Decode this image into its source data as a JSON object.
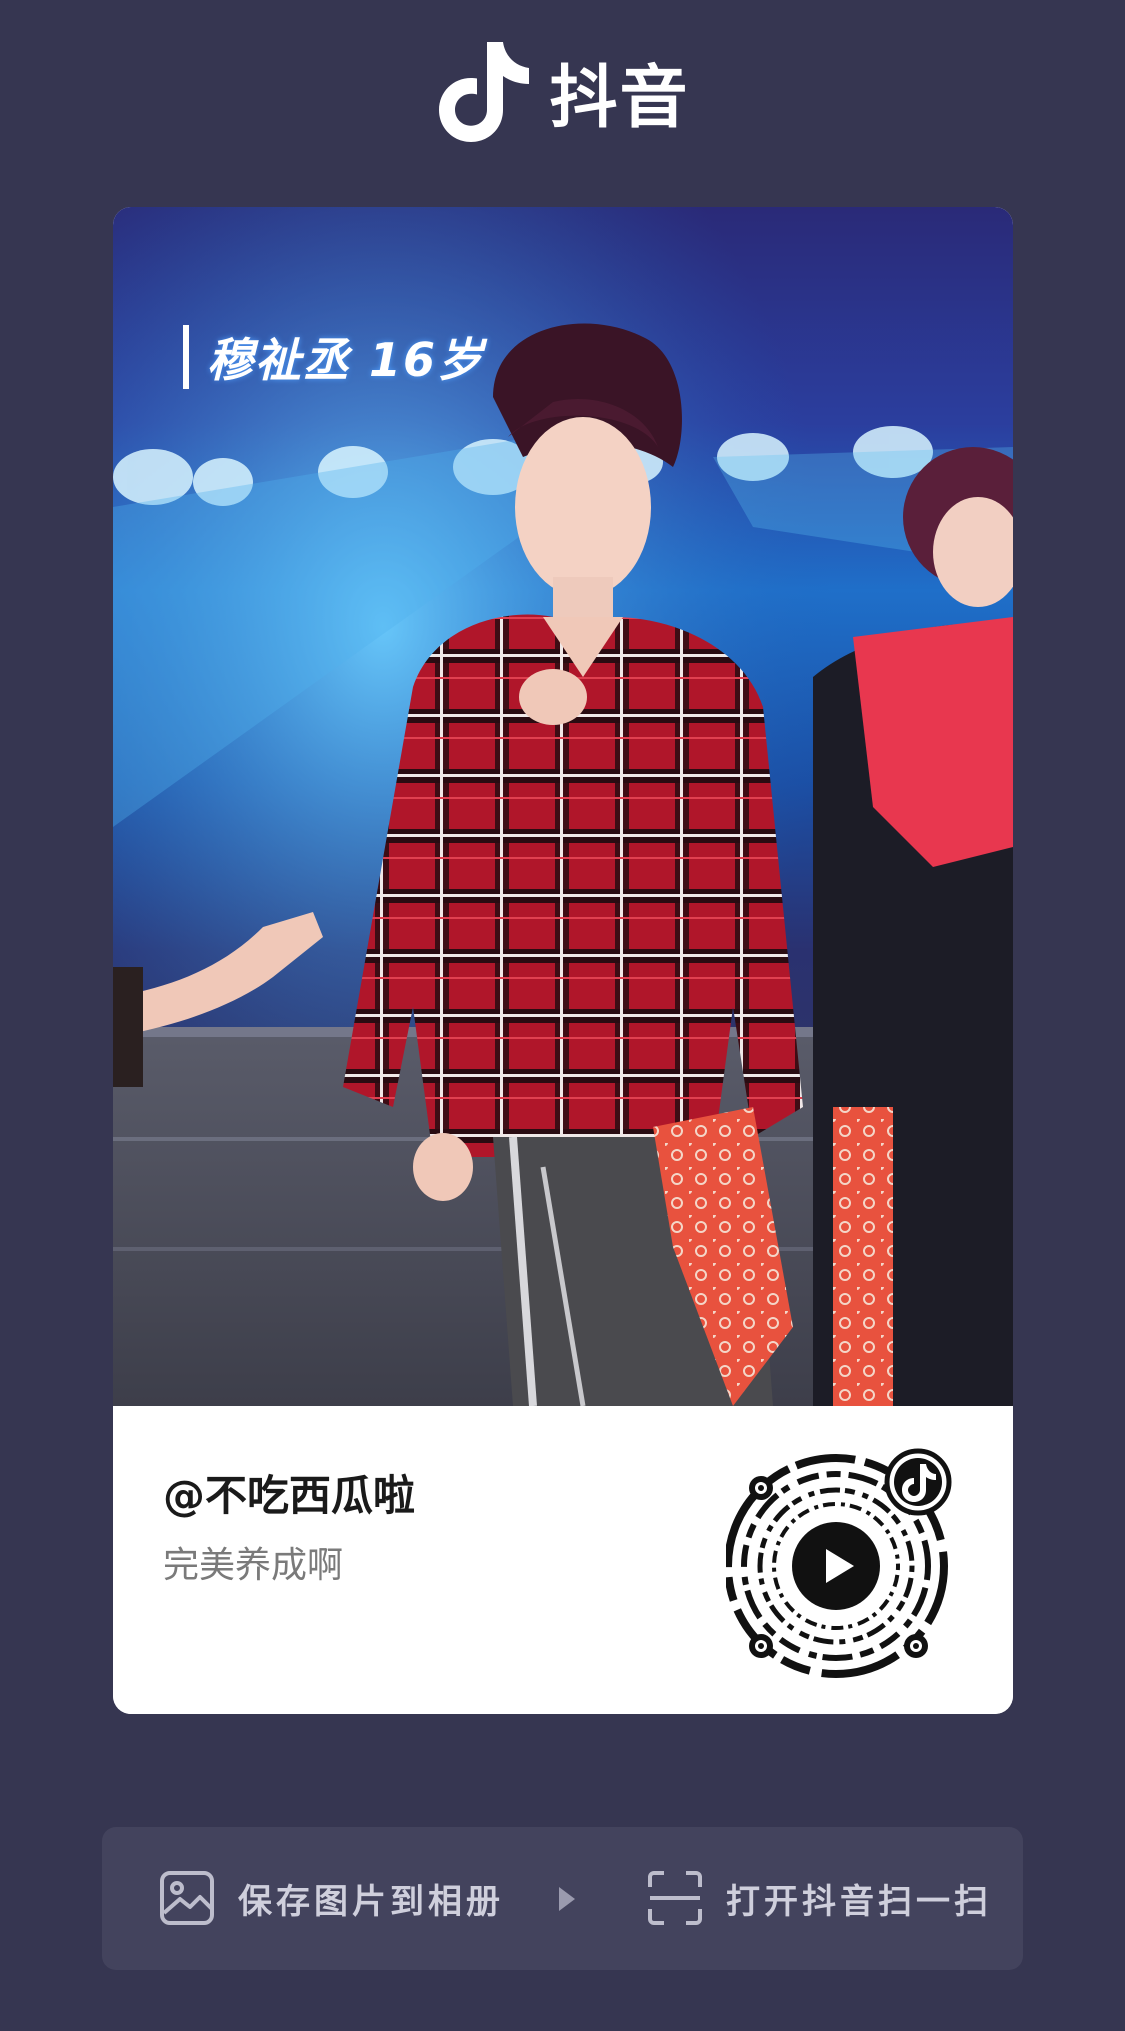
{
  "header": {
    "app_name": "抖音",
    "logo_icon": "douyin-note-icon"
  },
  "card": {
    "video": {
      "overlay_caption": "穆祉丞 16岁"
    },
    "author": {
      "username": "@不吃西瓜啦",
      "caption": "完美养成啊"
    },
    "qr_code": {
      "center_icon": "play-icon",
      "badge_icon": "douyin-note-icon"
    }
  },
  "actions": {
    "save_label": "保存图片到相册",
    "save_icon": "image-icon",
    "separator_icon": "triangle-right-icon",
    "open_label": "打开抖音扫一扫",
    "open_icon": "scan-icon"
  },
  "colors": {
    "background": "#363651",
    "action_bar": "#43435d",
    "card": "#ffffff",
    "username": "#1a1a1a",
    "caption": "#7a7a7a",
    "action_text": "#cfcfdc"
  }
}
